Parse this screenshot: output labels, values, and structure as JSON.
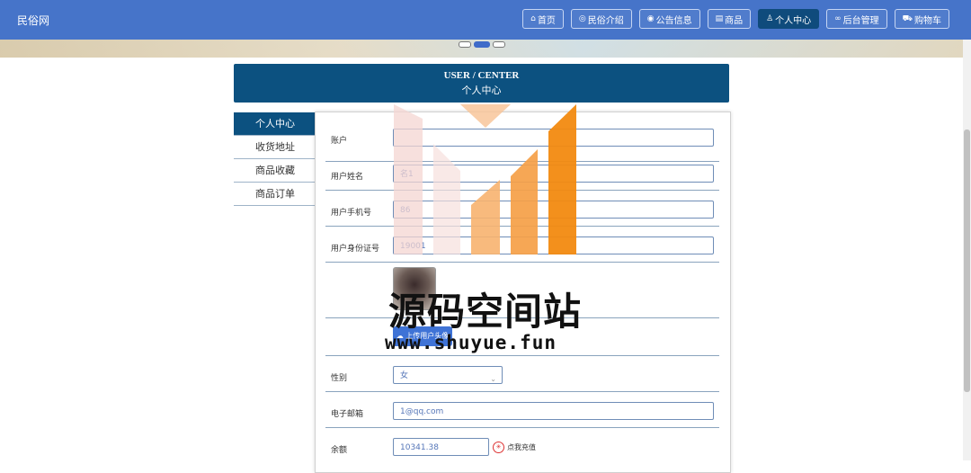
{
  "header": {
    "brand": "民俗网",
    "nav": [
      {
        "icon": "home-icon",
        "glyph": "⌂",
        "label": "首页",
        "active": false
      },
      {
        "icon": "globe-icon",
        "glyph": "◎",
        "label": "民俗介绍",
        "active": false
      },
      {
        "icon": "notice-icon",
        "glyph": "◉",
        "label": "公告信息",
        "active": false
      },
      {
        "icon": "goods-icon",
        "glyph": "▤",
        "label": "商品",
        "active": false
      },
      {
        "icon": "user-icon",
        "glyph": "♙",
        "label": "个人中心",
        "active": true
      },
      {
        "icon": "link-icon",
        "glyph": "∞",
        "label": "后台管理",
        "active": false
      },
      {
        "icon": "cart-icon",
        "glyph": "⛟",
        "label": "购物车",
        "active": false
      }
    ]
  },
  "page": {
    "title_en": "USER / CENTER",
    "title_zh": "个人中心"
  },
  "sidebar": {
    "items": [
      {
        "label": "个人中心",
        "active": true
      },
      {
        "label": "收货地址",
        "active": false
      },
      {
        "label": "商品收藏",
        "active": false
      },
      {
        "label": "商品订单",
        "active": false
      }
    ]
  },
  "form": {
    "account_label": "账户",
    "account_value": "",
    "name_label": "用户姓名",
    "name_value": "名1",
    "phone_label": "用户手机号",
    "phone_value": "86",
    "idcard_label": "用户身份证号",
    "idcard_value": "19001",
    "upload_label": "上传用户头像",
    "gender_label": "性别",
    "gender_value": "女",
    "email_label": "电子邮箱",
    "email_value": "1@qq.com",
    "balance_label": "余额",
    "balance_value": "10341.38",
    "recharge_label": "点我充值"
  },
  "watermark": {
    "title": "源码空间站",
    "url": "www.shuyue.fun"
  },
  "colors": {
    "navbar": "#4674c9",
    "active_nav": "#0f4b7c",
    "title_bg": "#0c5180",
    "upload_btn": "#3f73d6"
  }
}
